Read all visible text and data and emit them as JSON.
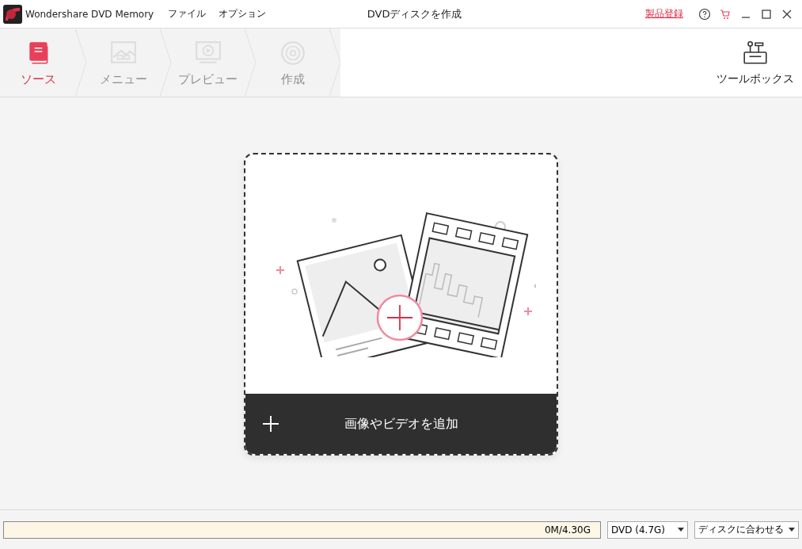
{
  "window": {
    "app_name": "Wondershare DVD Memory",
    "title": "DVDディスクを作成",
    "register_link": "製品登録"
  },
  "menu": [
    "ファイル",
    "オプション"
  ],
  "steps": [
    {
      "label": "ソース",
      "kind": "source",
      "selected": true
    },
    {
      "label": "メニュー",
      "kind": "menu",
      "selected": false
    },
    {
      "label": "プレビュー",
      "kind": "preview",
      "selected": false
    },
    {
      "label": "作成",
      "kind": "burn",
      "selected": false
    }
  ],
  "toolbox": {
    "label": "ツールボックス"
  },
  "drop_area": {
    "button_label": "画像やビデオを追加"
  },
  "status_bar": {
    "capacity": {
      "reading": "0M/4.30G",
      "level": 0
    },
    "disc_type": "DVD (4.7G)",
    "fit_mode": "ディスクに合わせる"
  }
}
